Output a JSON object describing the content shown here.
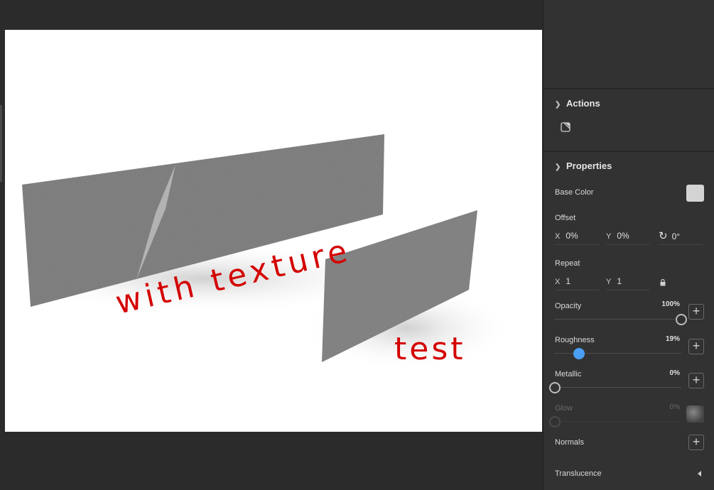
{
  "canvas": {
    "annotation_1": "with texture",
    "annotation_2": "test"
  },
  "colors": {
    "base_color": "#d4d4d4",
    "accent": "#4a9ff5",
    "annotation": "#d40000"
  },
  "actions": {
    "title": "Actions",
    "icon": "sticker-icon"
  },
  "properties": {
    "title": "Properties",
    "base_color_label": "Base Color",
    "offset": {
      "label": "Offset",
      "x_axis": "X",
      "x": "0%",
      "y_axis": "Y",
      "y": "0%",
      "rotation": "0°"
    },
    "repeat": {
      "label": "Repeat",
      "x_axis": "X",
      "x": "1",
      "y_axis": "Y",
      "y": "1"
    },
    "opacity": {
      "label": "Opacity",
      "value": "100%",
      "fraction": 1.0
    },
    "roughness": {
      "label": "Roughness",
      "value": "19%",
      "fraction": 0.19
    },
    "metallic": {
      "label": "Metallic",
      "value": "0%",
      "fraction": 0.0
    },
    "glow": {
      "label": "Glow",
      "value": "0%",
      "fraction": 0.0
    },
    "normals": {
      "label": "Normals"
    },
    "translucence": {
      "label": "Translucence"
    }
  }
}
